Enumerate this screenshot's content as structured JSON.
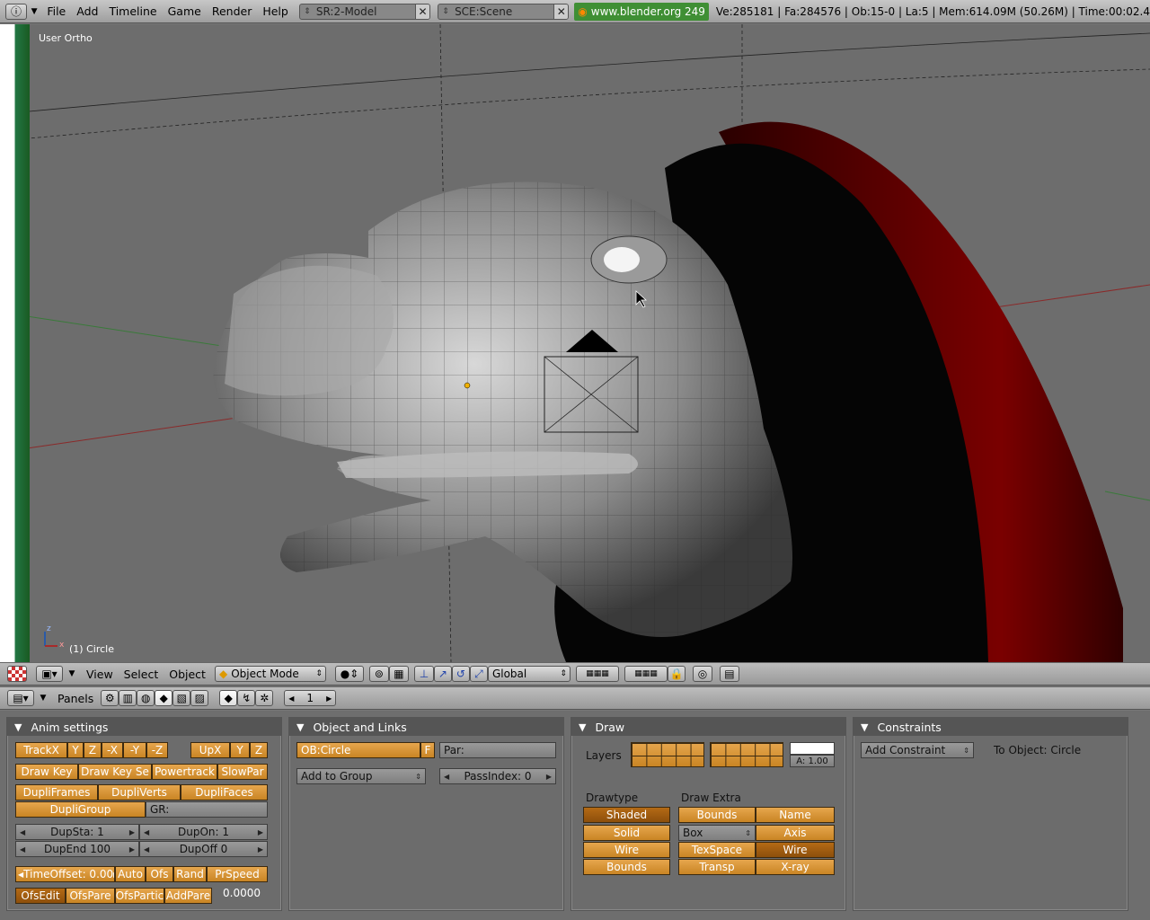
{
  "topbar": {
    "menus": [
      "File",
      "Add",
      "Timeline",
      "Game",
      "Render",
      "Help"
    ],
    "screen": "SR:2-Model",
    "scene": "SCE:Scene",
    "url": "www.blender.org 249",
    "stats": "Ve:285181 | Fa:284576 | Ob:15-0 | La:5   | Mem:614.09M (50.26M)  | Time:00:02.4"
  },
  "viewport": {
    "view_name": "User Ortho",
    "object_label": "(1) Circle",
    "axis_x": "x",
    "axis_z": "z"
  },
  "view3d_header": {
    "menus": [
      "View",
      "Select",
      "Object"
    ],
    "mode": "Object Mode",
    "orientation": "Global"
  },
  "buttons_header": {
    "panels_label": "Panels",
    "frame": "1"
  },
  "anim": {
    "title": "Anim settings",
    "track": [
      "TrackX",
      "Y",
      "Z",
      "-X",
      "-Y",
      "-Z"
    ],
    "up": [
      "UpX",
      "Y",
      "Z"
    ],
    "row2": [
      "Draw Key",
      "Draw Key Se",
      "Powertrack",
      "SlowPar"
    ],
    "dupli": [
      "DupliFrames",
      "DupliVerts",
      "DupliFaces"
    ],
    "dupligroup": "DupliGroup",
    "gr": "GR:",
    "dupsta": "DupSta: 1",
    "dupon": "DupOn: 1",
    "dupend": "DupEnd 100",
    "dupoff": "DupOff 0",
    "timeoffset": "TimeOffset: 0.00",
    "row7": [
      "Auto",
      "Ofs",
      "Rand",
      "PrSpeed"
    ],
    "row8": [
      "OfsEdit",
      "OfsPare",
      "OfsPartic",
      "AddPare"
    ],
    "val": "0.0000"
  },
  "objlinks": {
    "title": "Object and Links",
    "ob": "OB:Circle",
    "f": "F",
    "par": "Par:",
    "addgroup": "Add to Group",
    "passindex": "PassIndex: 0"
  },
  "draw": {
    "title": "Draw",
    "layers": "Layers",
    "alpha": "A: 1.00",
    "drawtype_label": "Drawtype",
    "drawextra_label": "Draw Extra",
    "drawtype": [
      "Shaded",
      "Solid",
      "Wire",
      "Bounds"
    ],
    "extra_left": [
      "Bounds",
      "Box",
      "TexSpace",
      "Transp"
    ],
    "extra_right": [
      "Name",
      "Axis",
      "Wire",
      "X-ray"
    ]
  },
  "constraints": {
    "title": "Constraints",
    "add": "Add Constraint",
    "to_object": "To Object: Circle"
  }
}
